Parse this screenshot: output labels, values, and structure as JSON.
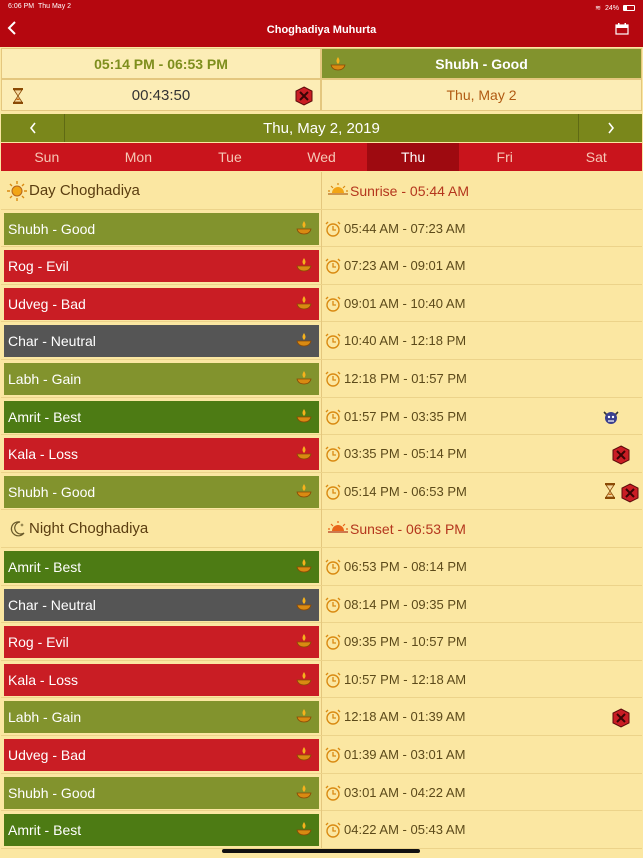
{
  "status_bar": {
    "time": "6:06 PM",
    "date": "Thu May 2",
    "battery": "24%"
  },
  "nav": {
    "title": "Choghadiya Muhurta"
  },
  "summary": {
    "current_time_range": "05:14 PM - 06:53 PM",
    "current_choghadiya": "Shubh - Good",
    "countdown": "00:43:50",
    "date": "Thu, May 2"
  },
  "date_bar": {
    "date": "Thu, May 2, 2019"
  },
  "week_days": [
    "Sun",
    "Mon",
    "Tue",
    "Wed",
    "Thu",
    "Fri",
    "Sat"
  ],
  "day_section": {
    "label": "Day Choghadiya",
    "sunrise": "Sunrise - 05:44 AM"
  },
  "night_section": {
    "label": "Night Choghadiya",
    "sunset": "Sunset - 06:53 PM"
  },
  "day_rows": [
    {
      "name": "Shubh - Good",
      "time": "05:44 AM - 07:23 AM"
    },
    {
      "name": "Rog - Evil",
      "time": "07:23 AM - 09:01 AM"
    },
    {
      "name": "Udveg - Bad",
      "time": "09:01 AM - 10:40 AM"
    },
    {
      "name": "Char - Neutral",
      "time": "10:40 AM - 12:18 PM"
    },
    {
      "name": "Labh - Gain",
      "time": "12:18 PM - 01:57 PM"
    },
    {
      "name": "Amrit - Best",
      "time": "01:57 PM - 03:35 PM"
    },
    {
      "name": "Kala - Loss",
      "time": "03:35 PM - 05:14 PM"
    },
    {
      "name": "Shubh - Good",
      "time": "05:14 PM - 06:53 PM"
    }
  ],
  "night_rows": [
    {
      "name": "Amrit - Best",
      "time": "06:53 PM - 08:14 PM"
    },
    {
      "name": "Char - Neutral",
      "time": "08:14 PM - 09:35 PM"
    },
    {
      "name": "Rog - Evil",
      "time": "09:35 PM - 10:57 PM"
    },
    {
      "name": "Kala - Loss",
      "time": "10:57 PM - 12:18 AM"
    },
    {
      "name": "Labh - Gain",
      "time": "12:18 AM - 01:39 AM"
    },
    {
      "name": "Udveg - Bad",
      "time": "01:39 AM - 03:01 AM"
    },
    {
      "name": "Shubh - Good",
      "time": "03:01 AM - 04:22 AM"
    },
    {
      "name": "Amrit - Best",
      "time": "04:22 AM - 05:43 AM"
    }
  ],
  "colors": {
    "header_red": "#b5070f",
    "good_olive": "#82932d",
    "evil_red": "#c91d24",
    "neutral_gray": "#555555",
    "best_green": "#4d7b14",
    "background": "#fbe7a2"
  }
}
